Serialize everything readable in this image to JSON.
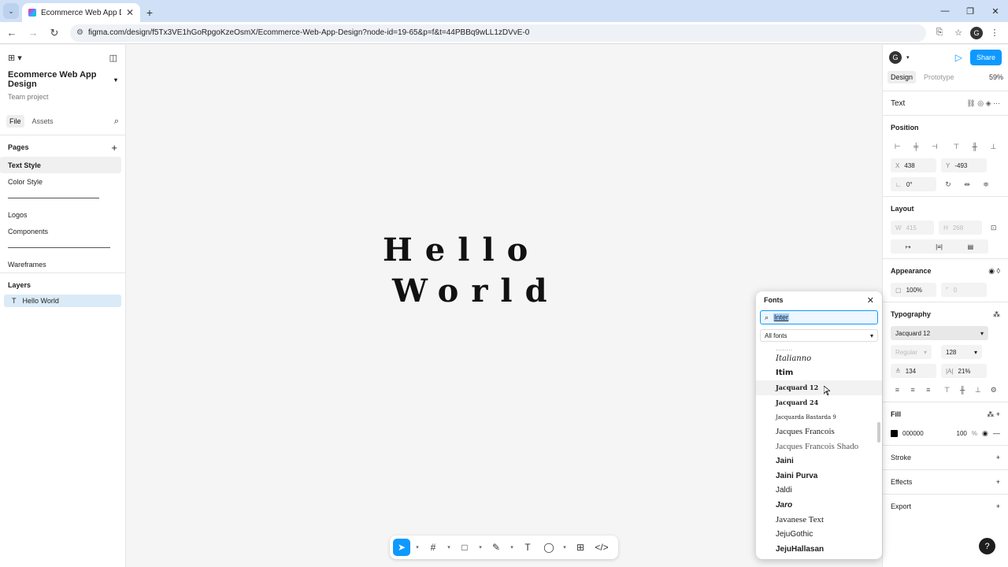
{
  "browser": {
    "tab_title": "Ecommerce Web App Design –",
    "url": "figma.com/design/f5Tx3VE1hGoRpgoKzeOsmX/Ecommerce-Web-App-Design?node-id=19-65&p=f&t=44PBBq9wLL1zDVvE-0",
    "profile_initial": "G"
  },
  "left": {
    "project_name": "Ecommerce Web App Design",
    "project_sub": "Team project",
    "tabs": [
      "File",
      "Assets"
    ],
    "pages_title": "Pages",
    "pages": [
      "Text Style",
      "Color Style",
      "Logos",
      "Components",
      "Wareframes"
    ],
    "layers_title": "Layers",
    "layer": "Hello World"
  },
  "canvas": {
    "line1": "Hello",
    "line2": "World"
  },
  "right": {
    "avatar": "G",
    "share": "Share",
    "tabs": [
      "Design",
      "Prototype"
    ],
    "zoom": "59%",
    "sel": "Text",
    "position_title": "Position",
    "x_label": "X",
    "x": "438",
    "y_label": "Y",
    "y": "-493",
    "rotation": "0°",
    "layout_title": "Layout",
    "w_label": "W",
    "w": "415",
    "h_label": "H",
    "h": "268",
    "appearance_title": "Appearance",
    "opacity": "100%",
    "radius": "0",
    "typography_title": "Typography",
    "font": "Jacquard 12",
    "weight": "Regular",
    "size": "128",
    "line_height": "134",
    "letter_spacing": "21%",
    "fill_title": "Fill",
    "fill_hex": "000000",
    "fill_opacity": "100",
    "fill_pct": "%",
    "stroke_title": "Stroke",
    "effects_title": "Effects",
    "export_title": "Export"
  },
  "fonts": {
    "title": "Fonts",
    "search": "Inter",
    "filter": "All fonts",
    "items": [
      "Italianno",
      "Itim",
      "Jacquard 12",
      "Jacquard 24",
      "Jacquarda Bastarda 9",
      "Jacques Francois",
      "Jacques Francois Shado",
      "Jaini",
      "Jaini Purva",
      "Jaldi",
      "Jaro",
      "Javanese Text",
      "JejuGothic",
      "JejuHallasan"
    ],
    "hovered_index": 2
  },
  "help": "?"
}
